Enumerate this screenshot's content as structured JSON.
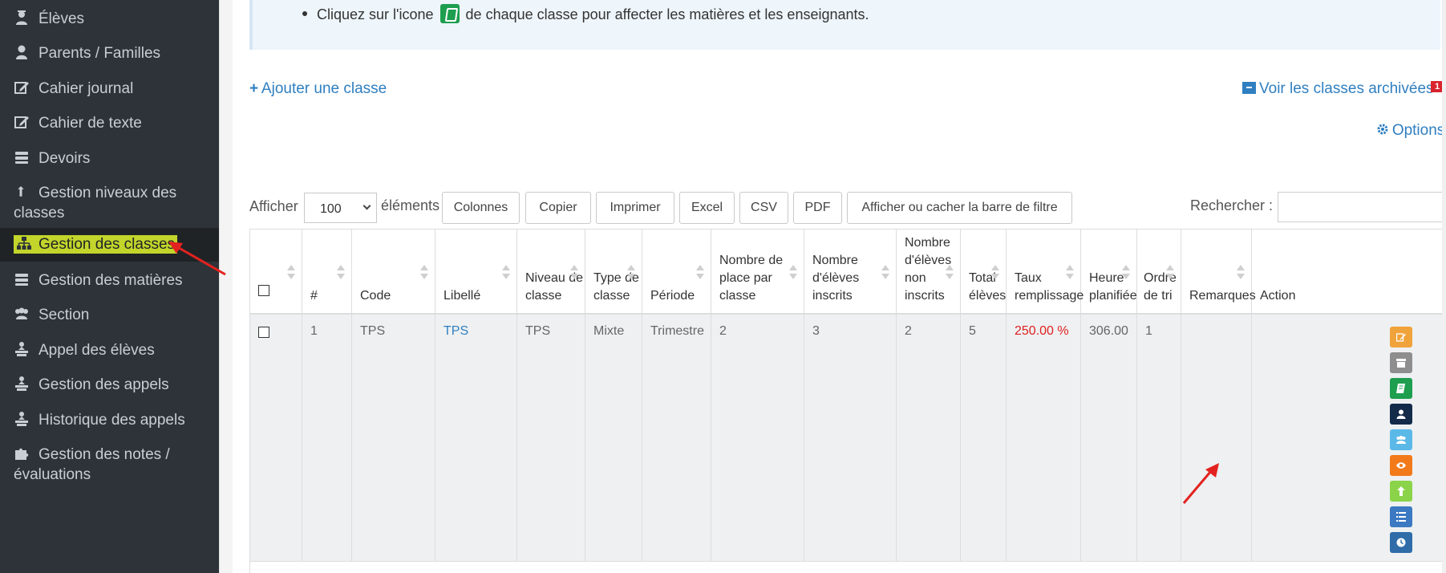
{
  "sidebar": {
    "items": [
      {
        "label": "Élèves",
        "icon": "graduate-icon"
      },
      {
        "label": "Parents / Familles",
        "icon": "user-icon"
      },
      {
        "label": "Cahier journal",
        "icon": "edit-icon"
      },
      {
        "label": "Cahier de texte",
        "icon": "edit-icon"
      },
      {
        "label": "Devoirs",
        "icon": "stack-icon"
      },
      {
        "label": "Gestion niveaux des",
        "label2": "classes",
        "icon": "level-arrow-icon"
      },
      {
        "label": "Gestion des classes",
        "icon": "sitemap-icon"
      },
      {
        "label": "Gestion des matières",
        "icon": "stack-icon"
      },
      {
        "label": "Section",
        "icon": "users-icon"
      },
      {
        "label": "Appel des élèves",
        "icon": "classroom-icon"
      },
      {
        "label": "Gestion des appels",
        "icon": "classroom-icon"
      },
      {
        "label": "Historique des appels",
        "icon": "classroom-icon"
      },
      {
        "label": "Gestion des notes /",
        "label2": "évaluations",
        "icon": "puzzle-icon"
      }
    ]
  },
  "info": {
    "text_before": "Cliquez sur l'icone",
    "text_after": "de chaque classe pour affecter les matières et les enseignants."
  },
  "links": {
    "add_class": "Ajouter une classe",
    "archived": "Voir les classes archivées",
    "archived_badge": "1",
    "options": "Options"
  },
  "toolbar": {
    "show_label": "Afficher",
    "page_size": "100",
    "elements_label": "éléments",
    "buttons": [
      "Colonnes",
      "Copier",
      "Imprimer",
      "Excel",
      "CSV",
      "PDF",
      "Afficher ou cacher la barre de filtre"
    ],
    "search_label": "Rechercher :"
  },
  "table": {
    "headers": [
      {
        "lines": [
          ""
        ],
        "key": "select"
      },
      {
        "lines": [
          "#"
        ]
      },
      {
        "lines": [
          "Code"
        ]
      },
      {
        "lines": [
          "Libellé"
        ]
      },
      {
        "lines": [
          "Niveau de",
          "classe"
        ]
      },
      {
        "lines": [
          "Type de",
          "classe"
        ]
      },
      {
        "lines": [
          "Période"
        ]
      },
      {
        "lines": [
          "Nombre de",
          "place par classe"
        ]
      },
      {
        "lines": [
          "Nombre",
          "d'élèves inscrits"
        ]
      },
      {
        "lines": [
          "Nombre",
          "d'élèves",
          "non",
          "inscrits"
        ]
      },
      {
        "lines": [
          "Total",
          "élèves"
        ]
      },
      {
        "lines": [
          "Taux",
          "remplissage"
        ]
      },
      {
        "lines": [
          "Heure",
          "planifiée"
        ]
      },
      {
        "lines": [
          "Ordre",
          "de tri"
        ]
      },
      {
        "lines": [
          "Remarques"
        ]
      },
      {
        "lines": [
          "Action"
        ]
      }
    ],
    "rows": [
      {
        "num": "1",
        "code": "TPS",
        "libelle": "TPS",
        "niveau": "TPS",
        "type": "Mixte",
        "periode": "Trimestre",
        "places": "2",
        "inscrits": "3",
        "non_inscrits": "2",
        "total": "5",
        "taux": "250.00 %",
        "heure": "306.00",
        "ordre": "1",
        "remarques": ""
      }
    ]
  },
  "action_buttons": [
    {
      "name": "edit-icon",
      "color": "#f0a33a"
    },
    {
      "name": "archive-icon",
      "color": "#8e8e8e"
    },
    {
      "name": "book-icon",
      "color": "#1e9e4f"
    },
    {
      "name": "user-icon",
      "color": "#142a49"
    },
    {
      "name": "users-icon",
      "color": "#5bb9e8"
    },
    {
      "name": "eye-icon",
      "color": "#f27a1a"
    },
    {
      "name": "level-up-icon",
      "color": "#8bd44a"
    },
    {
      "name": "list-icon",
      "color": "#3b79c2"
    },
    {
      "name": "clock-icon",
      "color": "#2f6ca8"
    }
  ],
  "colors": {
    "sidebar_bg": "#2d3338",
    "highlight": "#c3d52b",
    "link": "#2f7fc1",
    "danger": "#e0201f"
  }
}
